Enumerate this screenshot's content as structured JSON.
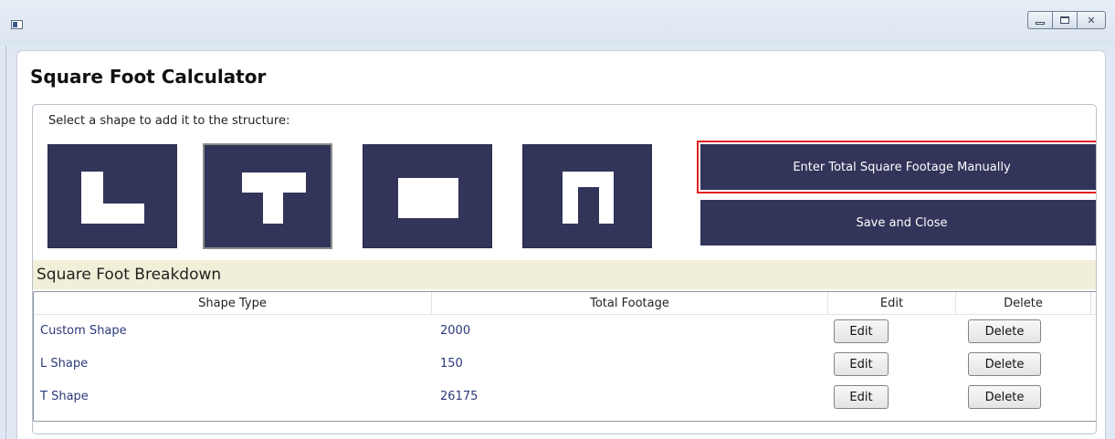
{
  "window": {
    "minimize_icon": "minimize-icon",
    "maximize_icon": "maximize-icon",
    "close_icon": "close-icon"
  },
  "page": {
    "title": "Square Foot Calculator",
    "instruction": "Select a shape to add it to the structure:"
  },
  "shapes": [
    {
      "name": "L shape",
      "icon": "l-shape-icon",
      "selected": false
    },
    {
      "name": "T shape",
      "icon": "t-shape-icon",
      "selected": true
    },
    {
      "name": "Rectangle shape",
      "icon": "rectangle-shape-icon",
      "selected": false
    },
    {
      "name": "U shape",
      "icon": "u-shape-icon",
      "selected": false
    }
  ],
  "actions": {
    "manual_label": "Enter Total Square Footage Manually",
    "save_label": "Save and Close"
  },
  "breakdown": {
    "title": "Square Foot Breakdown",
    "columns": [
      "Shape Type",
      "Total Footage",
      "Edit",
      "Delete"
    ],
    "rows": [
      {
        "shape": "Custom Shape",
        "footage": "2000",
        "edit": "Edit",
        "delete": "Delete"
      },
      {
        "shape": "L Shape",
        "footage": "150",
        "edit": "Edit",
        "delete": "Delete"
      },
      {
        "shape": "T Shape",
        "footage": "26175",
        "edit": "Edit",
        "delete": "Delete"
      }
    ]
  },
  "colors": {
    "button_bg": "#323459",
    "breakdown_bg": "#f1efd8",
    "highlight": "#e02020",
    "row_text": "#2c3a7a"
  }
}
